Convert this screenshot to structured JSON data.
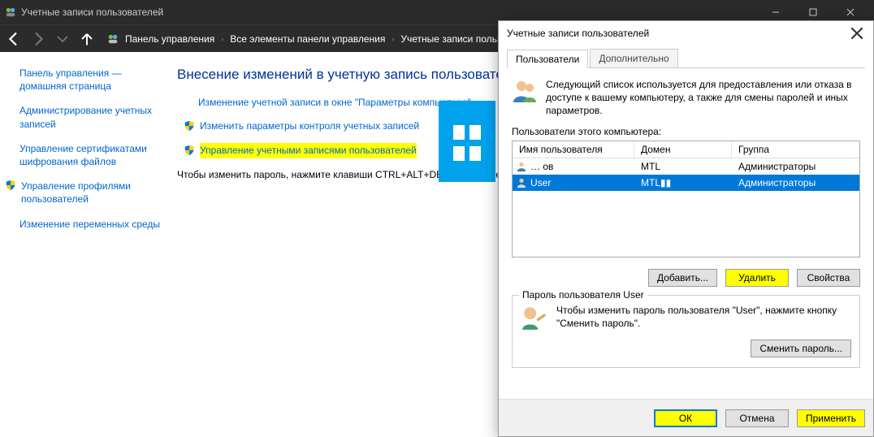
{
  "window": {
    "title": "Учетные записи пользователей"
  },
  "breadcrumb": {
    "root": "Панель управления",
    "level1": "Все элементы панели управления",
    "level2": "Учетные записи польз"
  },
  "sidebar": {
    "home": "Панель управления — домашняя страница",
    "admin_creds": "Администрирование учетных записей",
    "manage_certs": "Управление сертификатами шифрования файлов",
    "manage_profiles": "Управление профилями пользователей",
    "env_vars": "Изменение переменных среды"
  },
  "main": {
    "heading": "Внесение изменений в учетную запись пользователя",
    "link_change_pc_settings": "Изменение учетной записи в окне \"Параметры компьютера\"",
    "link_uac": "Изменить параметры контроля учетных записей",
    "link_manage_accts": "Управление учетными записями пользователей",
    "hint": "Чтобы изменить пароль, нажмите клавиши CTRL+ALT+DELETE и выбе"
  },
  "dialog": {
    "title": "Учетные записи пользователей",
    "tab_users": "Пользователи",
    "tab_advanced": "Дополнительно",
    "description": "Следующий список используется для предоставления или отказа в доступе к вашему компьютеру, а также для смены паролей и иных параметров.",
    "users_of_computer": "Пользователи этого компьютера:",
    "col_username": "Имя пользователя",
    "col_domain": "Домен",
    "col_group": "Группа",
    "rows": [
      {
        "name": "… ов",
        "domain": "MTL",
        "group": "Администраторы"
      },
      {
        "name": "User",
        "domain": "MTL▮▮",
        "group": "Администраторы"
      }
    ],
    "btn_add": "Добавить...",
    "btn_remove": "Удалить",
    "btn_props": "Свойства",
    "pw_legend": "Пароль пользователя User",
    "pw_text": "Чтобы изменить пароль пользователя \"User\", нажмите кнопку \"Сменить пароль\".",
    "btn_change_pw": "Сменить пароль...",
    "btn_ok": "ОК",
    "btn_cancel": "Отмена",
    "btn_apply": "Применить"
  }
}
